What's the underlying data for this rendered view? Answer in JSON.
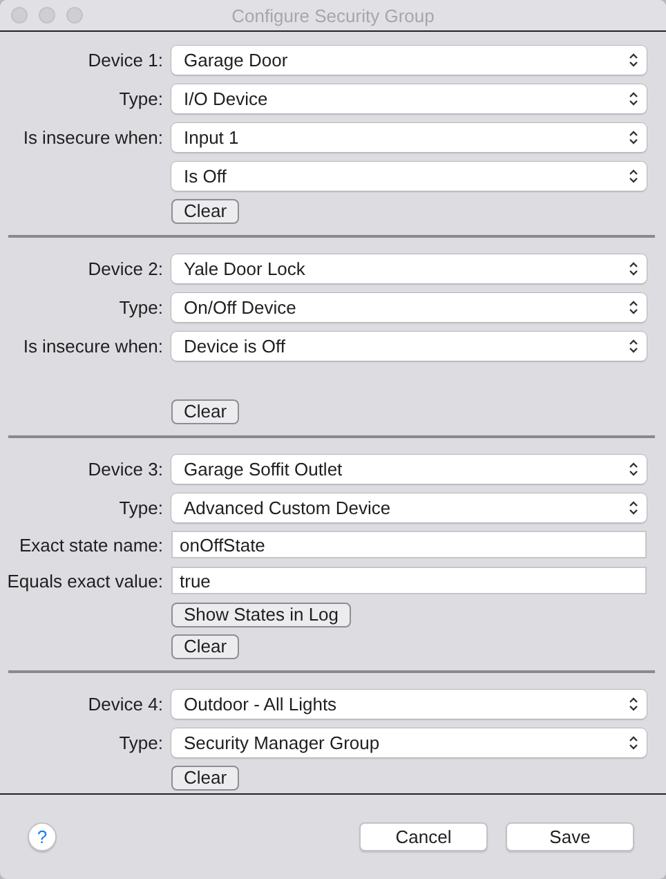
{
  "window": {
    "title": "Configure Security Group"
  },
  "sections": [
    {
      "rows": [
        {
          "kind": "select",
          "label": "Device 1:",
          "value": "Garage Door"
        },
        {
          "kind": "select",
          "label": "Type:",
          "value": "I/O Device"
        },
        {
          "kind": "select",
          "label": "Is insecure when:",
          "value": "Input 1"
        },
        {
          "kind": "select",
          "value": "Is Off"
        },
        {
          "kind": "button",
          "value": "Clear"
        }
      ]
    },
    {
      "rows": [
        {
          "kind": "select",
          "label": "Device 2:",
          "value": "Yale Door Lock"
        },
        {
          "kind": "select",
          "label": "Type:",
          "value": "On/Off Device"
        },
        {
          "kind": "select",
          "label": "Is insecure when:",
          "value": "Device is Off"
        },
        {
          "kind": "spacer"
        },
        {
          "kind": "button",
          "value": "Clear"
        }
      ]
    },
    {
      "rows": [
        {
          "kind": "select",
          "label": "Device 3:",
          "value": "Garage Soffit Outlet"
        },
        {
          "kind": "select",
          "label": "Type:",
          "value": "Advanced Custom Device"
        },
        {
          "kind": "text",
          "label": "Exact state name:",
          "value": "onOffState"
        },
        {
          "kind": "text",
          "label": "Equals exact value:",
          "value": "true"
        },
        {
          "kind": "button",
          "value": "Show States in Log"
        },
        {
          "kind": "button",
          "value": "Clear"
        }
      ]
    },
    {
      "rows": [
        {
          "kind": "select",
          "label": "Device 4:",
          "value": "Outdoor - All Lights"
        },
        {
          "kind": "select",
          "label": "Type:",
          "value": "Security Manager Group"
        },
        {
          "kind": "button",
          "value": "Clear"
        }
      ]
    }
  ],
  "footer": {
    "help": "?",
    "buttons": [
      "Cancel",
      "Save"
    ]
  }
}
